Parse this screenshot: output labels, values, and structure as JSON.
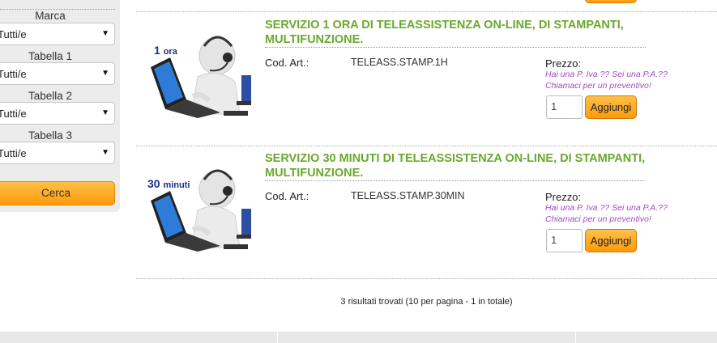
{
  "filters": {
    "groups": [
      {
        "label": "Marca",
        "selected": "Tutti/e"
      },
      {
        "label": "Tabella 1",
        "selected": "Tutti/e"
      },
      {
        "label": "Tabella 2",
        "selected": "Tutti/e"
      },
      {
        "label": "Tabella 3",
        "selected": "Tutti/e"
      }
    ],
    "search_button": "Cerca"
  },
  "products": [
    {
      "badge_number": "1",
      "badge_unit": "ora",
      "title": "SERVIZIO 1 ORA DI TELEASSISTENZA ON-LINE, DI STAMPANTI, MULTIFUNZIONE.",
      "code_label": "Cod. Art.:",
      "code": "TELEASS.STAMP.1H",
      "price_label": "Prezzo:",
      "price_note": "Hai una P. Iva ?? Sei una P.A.?? Chiamaci per un preventivo!",
      "quantity": "1",
      "add_label": "Aggiungi"
    },
    {
      "badge_number": "30",
      "badge_unit": "minuti",
      "title": "SERVIZIO 30 MINUTI DI TELEASSISTENZA ON-LINE, DI STAMPANTI, MULTIFUNZIONE.",
      "code_label": "Cod. Art.:",
      "code": "TELEASS.STAMP.30MIN",
      "price_label": "Prezzo:",
      "price_note": "Hai una P. Iva ?? Sei una P.A.?? Chiamaci per un preventivo!",
      "quantity": "1",
      "add_label": "Aggiungi"
    }
  ],
  "results_summary": "3 risultati trovati (10 per pagina - 1 in totale)",
  "colors": {
    "title_green": "#6aa82e",
    "button_orange": "#fd9b0b",
    "note_purple": "#a24bc4",
    "badge_blue": "#1a2f8c"
  }
}
